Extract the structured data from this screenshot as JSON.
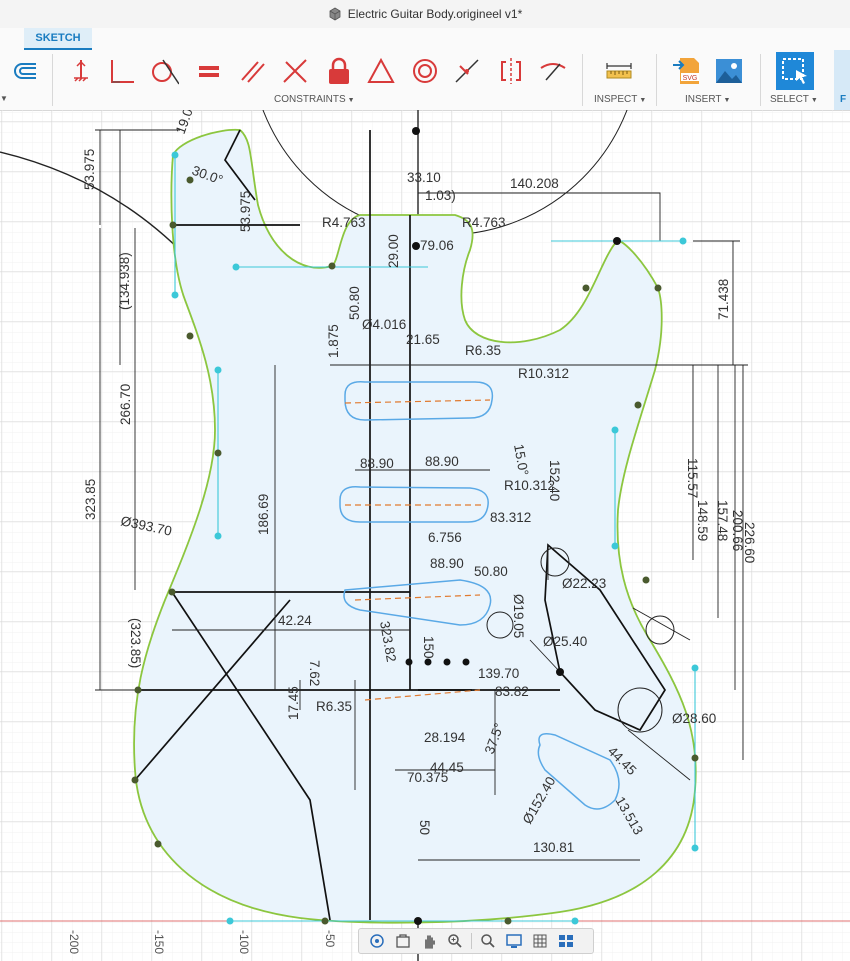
{
  "window": {
    "title": "Electric Guitar Body.origineel v1*"
  },
  "tabs": {
    "active": "SKETCH"
  },
  "toolbar": {
    "groups": {
      "constraints": "CONSTRAINTS",
      "inspect": "INSPECT",
      "insert": "INSERT",
      "select": "SELECT"
    },
    "icons": [
      "offset-icon",
      "fix-icon",
      "coincident-icon",
      "tangent-icon",
      "equal-icon",
      "parallel-icon",
      "perpendicular-icon",
      "lock-icon",
      "triangle-icon",
      "concentric-icon",
      "midpoint-icon",
      "symmetry-icon",
      "curvature-icon",
      "measure-icon",
      "insert-svg-icon",
      "insert-image-icon",
      "select-box-icon"
    ],
    "accent": "#1f88d8",
    "constraint_color": "#d83a3a"
  },
  "sketch": {
    "dimensions": {
      "d53975": "53.975",
      "d190": "19.0",
      "d300": "30.0°",
      "d5397b": "53.975",
      "d3310": "33.10",
      "d1003": "1.03)",
      "d140208": "140.208",
      "r4763a": "R4.763",
      "r4763b": "R4.763",
      "d2900": "29.00",
      "d1349": "(134.938)",
      "d7906": "79.06",
      "d71438": "71.438",
      "d5080": "50.80",
      "d4016": "Ø4.016",
      "d2165": "21.65",
      "r635": "R6.35",
      "d1875": "1.875",
      "d2670": "266.70",
      "r10312a": "R10.312",
      "d150": "15.0°",
      "d11557": "115.57",
      "d8890a": "88.90",
      "d8890b": "88.90",
      "d15240": "152.40",
      "r10312b": "R10.312",
      "d14859": "148.59",
      "d15748": "157.48",
      "d20066": "200.66",
      "d22860": "226.60",
      "d32385": "323.85",
      "d39370": "Ø393.70",
      "d18669": "186.69",
      "d83312": "83.312",
      "d6756": "6.756",
      "d8890c": "88.90",
      "d5080b": "50.80",
      "d2223": "Ø22.23",
      "d1905": "Ø19.05",
      "d2540": "Ø25.40",
      "d4224": "42.24",
      "d32385b": "(323.85)",
      "d3238c": "323.82",
      "d150b": "150",
      "d13970": "139.70",
      "d8382": "83.82",
      "d2860": "Ø28.60",
      "r635b": "R6.35",
      "d1745": "17.45",
      "d28194": "28.194",
      "d375": "37.5°",
      "d4445a": "44.45",
      "d4445b": "44.45",
      "d70375": "70.375",
      "d15240b": "Ø152.40",
      "d13513": "13.513",
      "d50": "50",
      "d13081": "130.81",
      "d7620": "7.62"
    },
    "axis_labels": [
      "-200",
      "-150",
      "-100",
      "-50"
    ]
  },
  "navbar": {
    "buttons": [
      "orbit-icon",
      "look-at-icon",
      "pan-icon",
      "zoom-icon",
      "zoom-window-icon",
      "display-settings-icon",
      "grid-icon",
      "viewports-icon"
    ]
  }
}
